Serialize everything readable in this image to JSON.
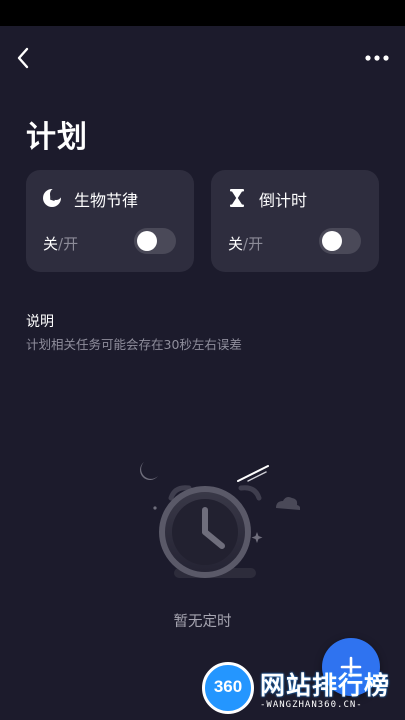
{
  "header": {
    "back_icon": "chevron-left-icon",
    "more_icon": "more-horizontal-icon"
  },
  "page": {
    "title": "计划"
  },
  "cards": [
    {
      "title": "生物节律",
      "icon": "moon-clock-icon",
      "state_on": "关",
      "separator": "/",
      "state_off": "开",
      "enabled": false
    },
    {
      "title": "倒计时",
      "icon": "hourglass-icon",
      "state_on": "关",
      "separator": "/",
      "state_off": "开",
      "enabled": false
    }
  ],
  "info": {
    "title": "说明",
    "description": "计划相关任务可能会存在30秒左右误差"
  },
  "empty_state": {
    "icon": "alarm-clock-icon",
    "text": "暂无定时"
  },
  "fab": {
    "icon": "plus-icon"
  },
  "watermark": {
    "logo": "360",
    "title": "网站排行榜",
    "subtitle": "-WANGZHAN360.CN-"
  },
  "colors": {
    "background": "#1c1b2c",
    "card": "#2e2d3e",
    "accent": "#2f73f0",
    "toggle_off": "#4a4958"
  }
}
